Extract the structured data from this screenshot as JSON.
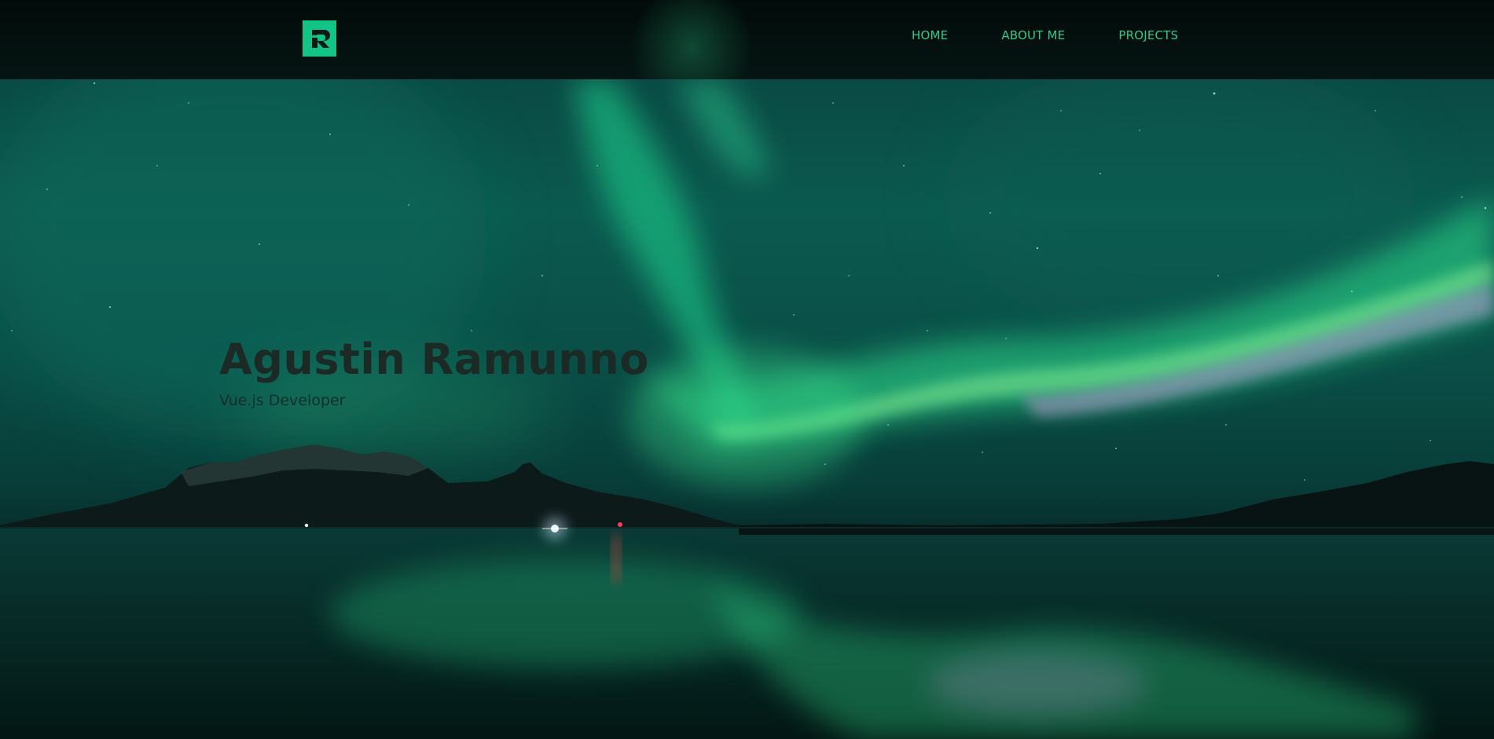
{
  "nav": {
    "logo_letter": "R",
    "links": [
      {
        "label": "HOME"
      },
      {
        "label": "ABOUT ME"
      },
      {
        "label": "PROJECTS"
      }
    ]
  },
  "hero": {
    "title": "Agustin Ramunno",
    "subtitle": "Vue.js Developer"
  },
  "colors": {
    "accent": "#12c486",
    "nav_text": "#34c98c",
    "nav_bg": "#031110",
    "title_text": "#1c2a26"
  },
  "icons": {
    "logo": "r-logo-icon"
  }
}
